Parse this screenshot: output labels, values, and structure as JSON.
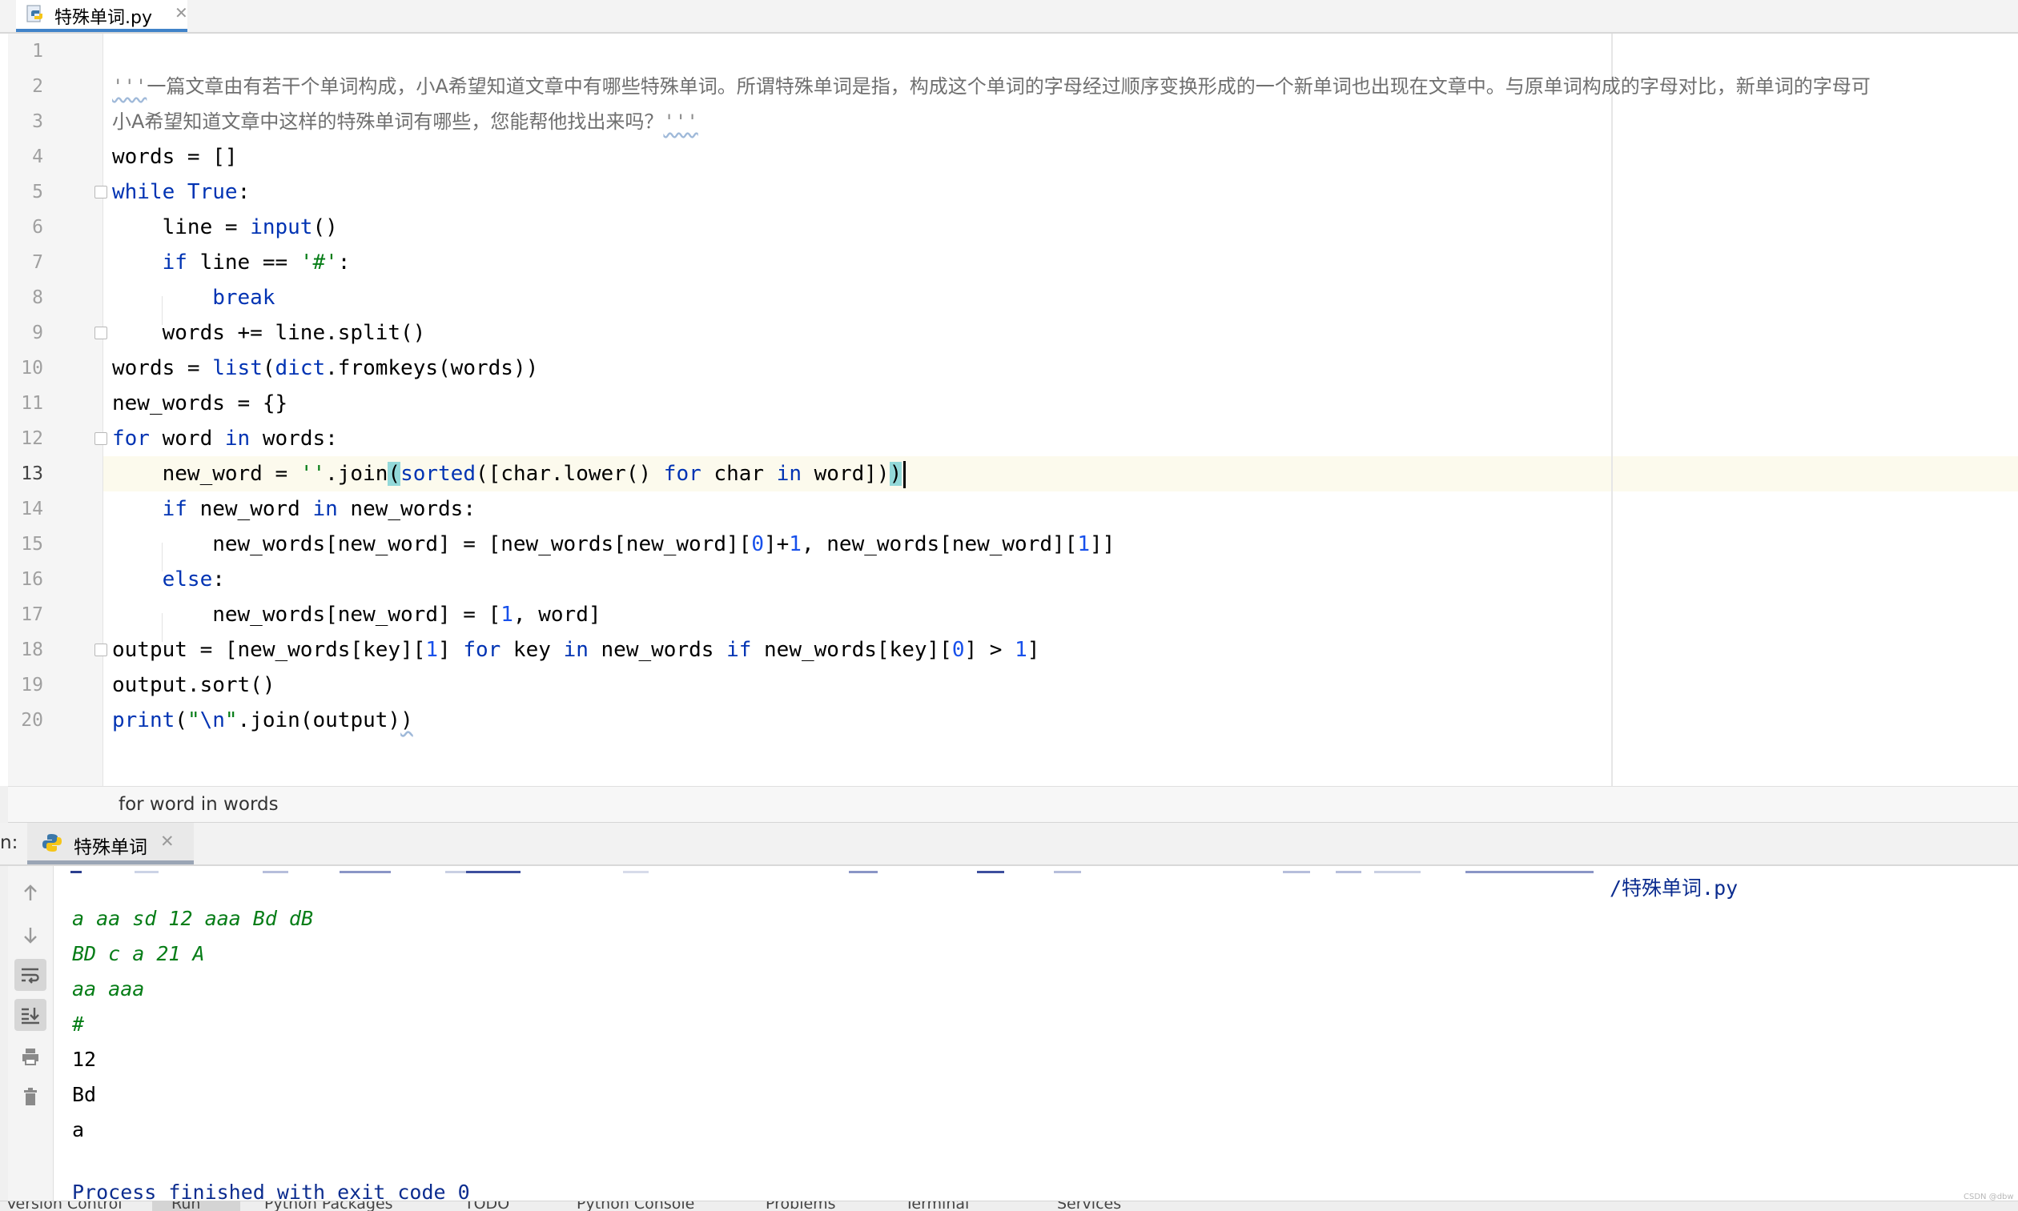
{
  "editor_tab": {
    "label": "特殊单词.py",
    "close": "✕"
  },
  "editor": {
    "line_numbers": [
      "1",
      "2",
      "3",
      "4",
      "5",
      "6",
      "7",
      "8",
      "9",
      "10",
      "11",
      "12",
      "13",
      "14",
      "15",
      "16",
      "17",
      "18",
      "19",
      "20"
    ],
    "lines": {
      "l2_quote": "'''",
      "l2_text": "一篇文章由有若干个单词构成，小A希望知道文章中有哪些特殊单词。所谓特殊单词是指，构成这个单词的字母经过顺序变换形成的一个新单词也出现在文章中。与原单词构成的字母对比，新单词的字母可",
      "l3_text": "小A希望知道文章中这样的特殊单词有哪些，您能帮他找出来吗？",
      "l3_quote": "'''",
      "l4": "words = []",
      "l5_kw": "while",
      "l5_true": " True",
      "l5_rest": ":",
      "l6_a": "    line = ",
      "l6_fn": "input",
      "l6_b": "()",
      "l7_kw": "    if",
      "l7_a": " line == ",
      "l7_str": "'#'",
      "l7_b": ":",
      "l8_kw": "        break",
      "l9": "    words += line.split()",
      "l10_a": "words = ",
      "l10_fn1": "list",
      "l10_b": "(",
      "l10_fn2": "dict",
      "l10_c": ".fromkeys(words))",
      "l11": "new_words = {}",
      "l12_kw1": "for",
      "l12_a": " word ",
      "l12_kw2": "in",
      "l12_b": " words:",
      "l13_a": "    new_word = ",
      "l13_str": "''",
      "l13_b": ".join",
      "l13_p1": "(",
      "l13_fn": "sorted",
      "l13_c": "([char.lower() ",
      "l13_kw1": "for",
      "l13_d": " char ",
      "l13_kw2": "in",
      "l13_e": " word])",
      "l13_p2": ")",
      "l14_kw1": "    if",
      "l14_a": " new_word ",
      "l14_kw2": "in",
      "l14_b": " new_words:",
      "l15_a": "        new_words[new_word] = [new_words[new_word][",
      "l15_n1": "0",
      "l15_b": "]+",
      "l15_n2": "1",
      "l15_c": ", new_words[new_word][",
      "l15_n3": "1",
      "l15_d": "]]",
      "l16_kw": "    else",
      "l16_a": ":",
      "l17_a": "        new_words[new_word] = [",
      "l17_n": "1",
      "l17_b": ", word]",
      "l18_a": "output = [new_words[key][",
      "l18_n1": "1",
      "l18_b": "] ",
      "l18_kw1": "for",
      "l18_c": " key ",
      "l18_kw2": "in",
      "l18_d": " new_words ",
      "l18_kw3": "if",
      "l18_e": " new_words[key][",
      "l18_n2": "0",
      "l18_f": "] > ",
      "l18_n3": "1",
      "l18_g": "]",
      "l19": "output.sort()",
      "l20_fn": "print",
      "l20_a": "(",
      "l20_str1": "\"",
      "l20_esc": "\\n",
      "l20_str2": "\"",
      "l20_b": ".join(output)",
      "l20_c": ")"
    }
  },
  "breadcrumb": "for word in words",
  "run_window": {
    "prefix": "n:",
    "tab_label": "特殊单词",
    "tab_close": "✕",
    "path": "/特殊单词.py",
    "input_lines": [
      "a aa sd 12 aaa Bd dB",
      "BD c a 21 A",
      "aa aaa",
      "#"
    ],
    "output_lines": [
      "12",
      "Bd",
      "a"
    ],
    "process_line": "Process finished with exit code 0",
    "tool_icons": [
      "arrow-up-icon",
      "arrow-down-icon",
      "soft-wrap-icon",
      "scroll-to-end-icon",
      "print-icon",
      "trash-icon"
    ]
  },
  "bottom_bar": {
    "items": [
      "Version Control",
      "Run",
      "Python Packages",
      "TODO",
      "Python Console",
      "Problems",
      "Terminal",
      "Services"
    ]
  },
  "watermark": "CSDN @dbw",
  "colors": {
    "keyword": "#0033b3",
    "string": "#067d17",
    "number": "#1750eb",
    "console_path": "#0b2c8f",
    "tab_underline": "#4083c9"
  }
}
